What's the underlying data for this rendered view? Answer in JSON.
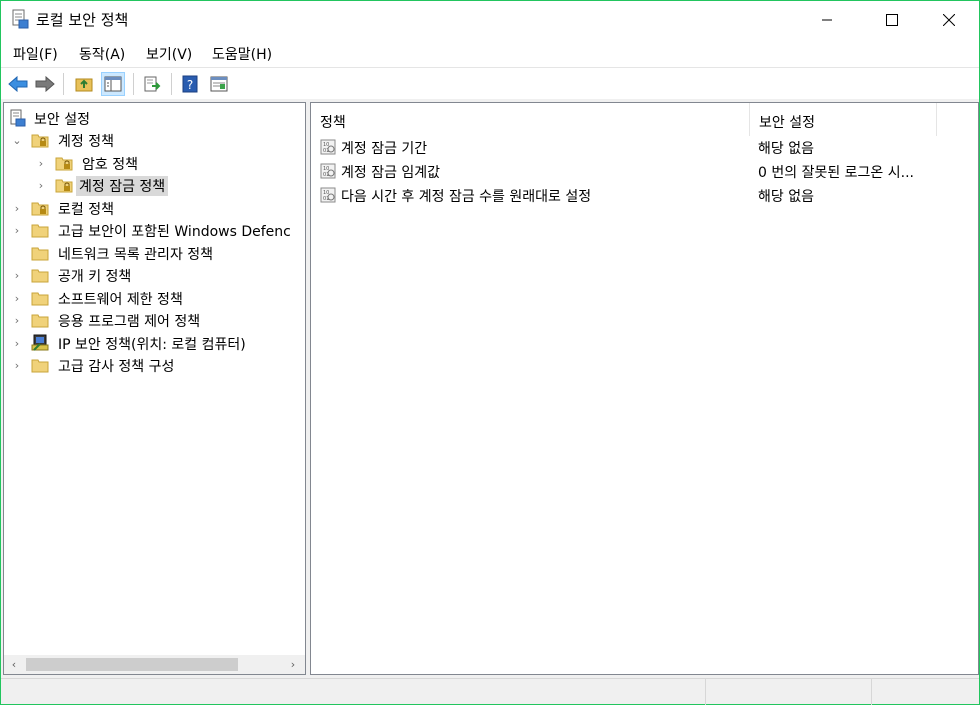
{
  "window": {
    "title": "로컬 보안 정책",
    "accent": "#22c55e"
  },
  "menu": [
    "파일(F)",
    "동작(A)",
    "보기(V)",
    "도움말(H)"
  ],
  "toolbar": {
    "buttons": [
      "back-icon",
      "forward-icon",
      "up-folder-icon",
      "show-hide-tree-icon",
      "export-list-icon",
      "help-icon",
      "properties-icon"
    ]
  },
  "tree": {
    "root": "보안 설정",
    "items": [
      {
        "label": "계정 정책",
        "expanded": true,
        "icon": "locked-folder-icon"
      },
      {
        "label": "암호 정책",
        "icon": "locked-folder-icon"
      },
      {
        "label": "계정 잠금 정책",
        "icon": "locked-folder-icon",
        "selected": true
      },
      {
        "label": "로컬 정책",
        "icon": "locked-folder-icon"
      },
      {
        "label": "고급 보안이 포함된 Windows Defenc",
        "icon": "folder-icon"
      },
      {
        "label": "네트워크 목록 관리자 정책",
        "icon": "folder-icon"
      },
      {
        "label": "공개 키 정책",
        "icon": "folder-icon"
      },
      {
        "label": "소프트웨어 제한 정책",
        "icon": "folder-icon"
      },
      {
        "label": "응용 프로그램 제어 정책",
        "icon": "folder-icon"
      },
      {
        "label": "IP 보안 정책(위치: 로컬 컴퓨터)",
        "icon": "ip-security-icon"
      },
      {
        "label": "고급 감사 정책 구성",
        "icon": "folder-icon"
      }
    ]
  },
  "list": {
    "columns": [
      "정책",
      "보안 설정"
    ],
    "rows": [
      {
        "name": "계정 잠금 기간",
        "value": "해당 없음"
      },
      {
        "name": "계정 잠금 임계값",
        "value": "0 번의 잘못된 로그온 시..."
      },
      {
        "name": "다음 시간 후 계정 잠금 수를 원래대로 설정",
        "value": "해당 없음"
      }
    ]
  }
}
